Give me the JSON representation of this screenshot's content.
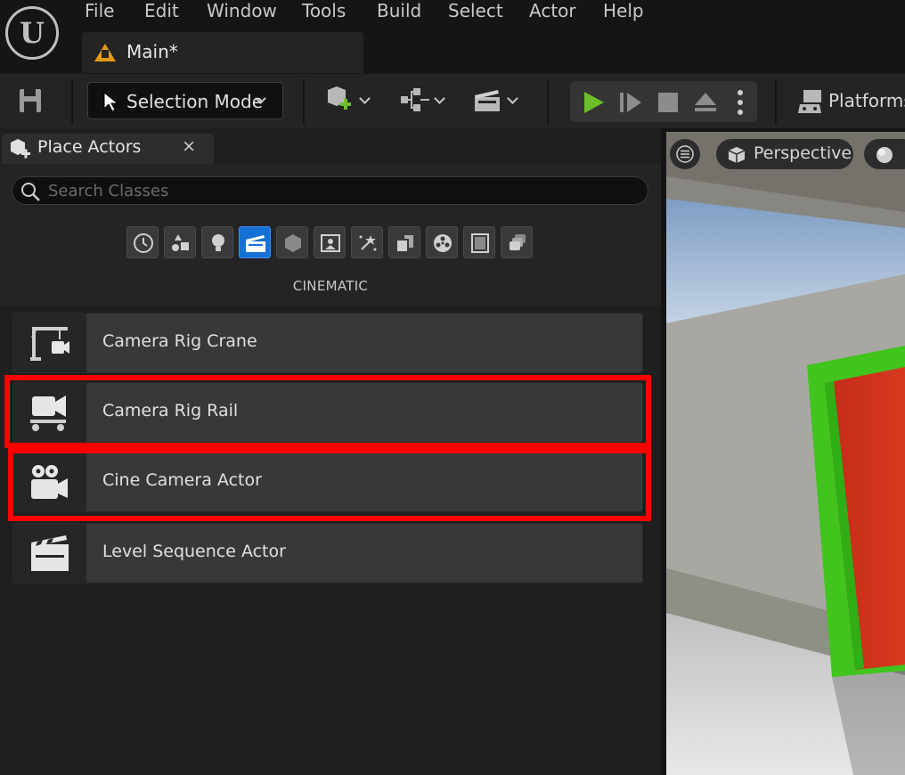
{
  "menu": {
    "items": [
      "File",
      "Edit",
      "Window",
      "Tools",
      "Build",
      "Select",
      "Actor",
      "Help"
    ]
  },
  "level_tab": {
    "label": "Main*"
  },
  "toolbar": {
    "selection_mode_label": "Selection Mode",
    "platforms_label": "Platforms"
  },
  "place_actors": {
    "tab_label": "Place Actors",
    "close_glyph": "×",
    "search_placeholder": "Search Classes",
    "category_icons": [
      "recently-placed-icon",
      "basic-shapes-icon",
      "lights-icon",
      "cinematic-icon",
      "visual-effects-icon",
      "geometry-icon",
      "volumes-icon",
      "all-classes-icon",
      "shapes-icon",
      "materials-icon",
      "books-icon",
      "layers-icon"
    ],
    "active_category": "cinematic-icon",
    "category_title": "CINEMATIC",
    "actors": [
      {
        "name": "Camera Rig Crane",
        "icon": "camera-rig-crane-icon",
        "highlighted": false
      },
      {
        "name": "Camera Rig Rail",
        "icon": "camera-rig-rail-icon",
        "highlighted": true
      },
      {
        "name": "Cine Camera Actor",
        "icon": "cine-camera-icon",
        "highlighted": true
      },
      {
        "name": "Level Sequence Actor",
        "icon": "clapperboard-icon",
        "highlighted": false
      }
    ]
  },
  "viewport": {
    "perspective_label": "Perspective"
  },
  "colors": {
    "accent_blue": "#1671d6",
    "play_green": "#6cbf2a",
    "highlight_red": "#ff0000",
    "level_warning": "#e39b1a"
  }
}
